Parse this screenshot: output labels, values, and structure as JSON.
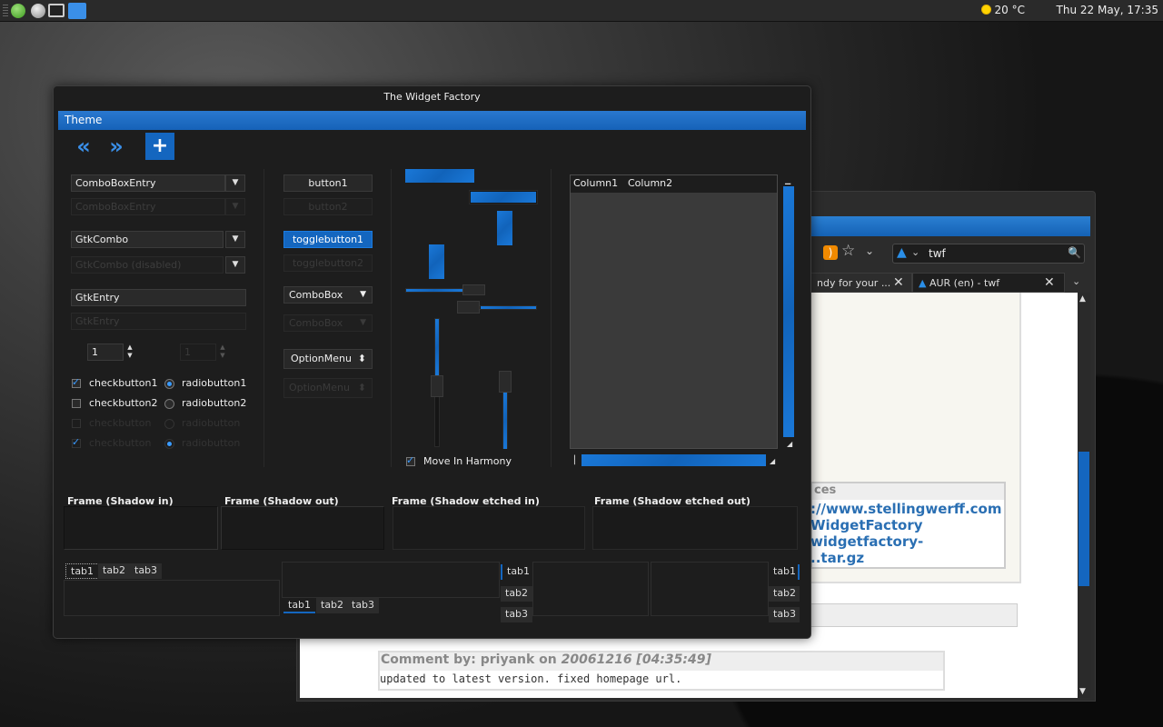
{
  "panel": {
    "weather": "20 °C",
    "clock": "Thu 22 May, 17:35"
  },
  "browser": {
    "search_value": "twf",
    "tabs": [
      "ndy for your ...",
      "AUR (en) - twf"
    ],
    "sources_heading": "ces",
    "source_links": [
      "://www.stellingwerff.com",
      "WidgetFactory",
      "widgetfactory-",
      "..tar.gz"
    ],
    "comment_heading": "Comment by: priyank on ",
    "comment_date": "20061216 [04:35:49]",
    "comment_body": "updated to latest version. fixed homepage url."
  },
  "wf": {
    "title": "The Widget Factory",
    "menu_theme": "Theme",
    "combos": {
      "combo_entry": "ComboBoxEntry",
      "combo_entry_dis": "ComboBoxEntry",
      "gtkcombo": "GtkCombo",
      "gtkcombo_dis": "GtkCombo (disabled)",
      "gtkentry": "GtkEntry",
      "gtkentry_dis": "GtkEntry"
    },
    "spin_value": "1",
    "spin_value_dis": "1",
    "checks": {
      "c1": "checkbutton1",
      "c2": "checkbutton2",
      "c3": "checkbutton",
      "c4": "checkbutton",
      "r1": "radiobutton1",
      "r2": "radiobutton2",
      "r3": "radiobutton",
      "r4": "radiobutton"
    },
    "buttons": {
      "b1": "button1",
      "b2": "button2",
      "t1": "togglebutton1",
      "t2": "togglebutton2",
      "combobox": "ComboBox",
      "combobox_dis": "ComboBox",
      "optionmenu": "OptionMenu",
      "optionmenu_dis": "OptionMenu"
    },
    "move_in_harmony": "Move In Harmony",
    "columns": [
      "Column1",
      "Column2"
    ],
    "frames": [
      "Frame (Shadow in)",
      "Frame (Shadow out)",
      "Frame (Shadow etched in)",
      "Frame (Shadow etched out)"
    ],
    "tabs": [
      "tab1",
      "tab2",
      "tab3"
    ]
  },
  "icons": {
    "prev": "«",
    "next": "»",
    "add": "+",
    "chevron": "⌄",
    "updown": "⬍",
    "star": "☆",
    "close": "✕",
    "search": "🔍"
  },
  "colors": {
    "accent": "#1466bf",
    "accent_light": "#3a8fe8",
    "window_bg": "#1d1d1d"
  }
}
